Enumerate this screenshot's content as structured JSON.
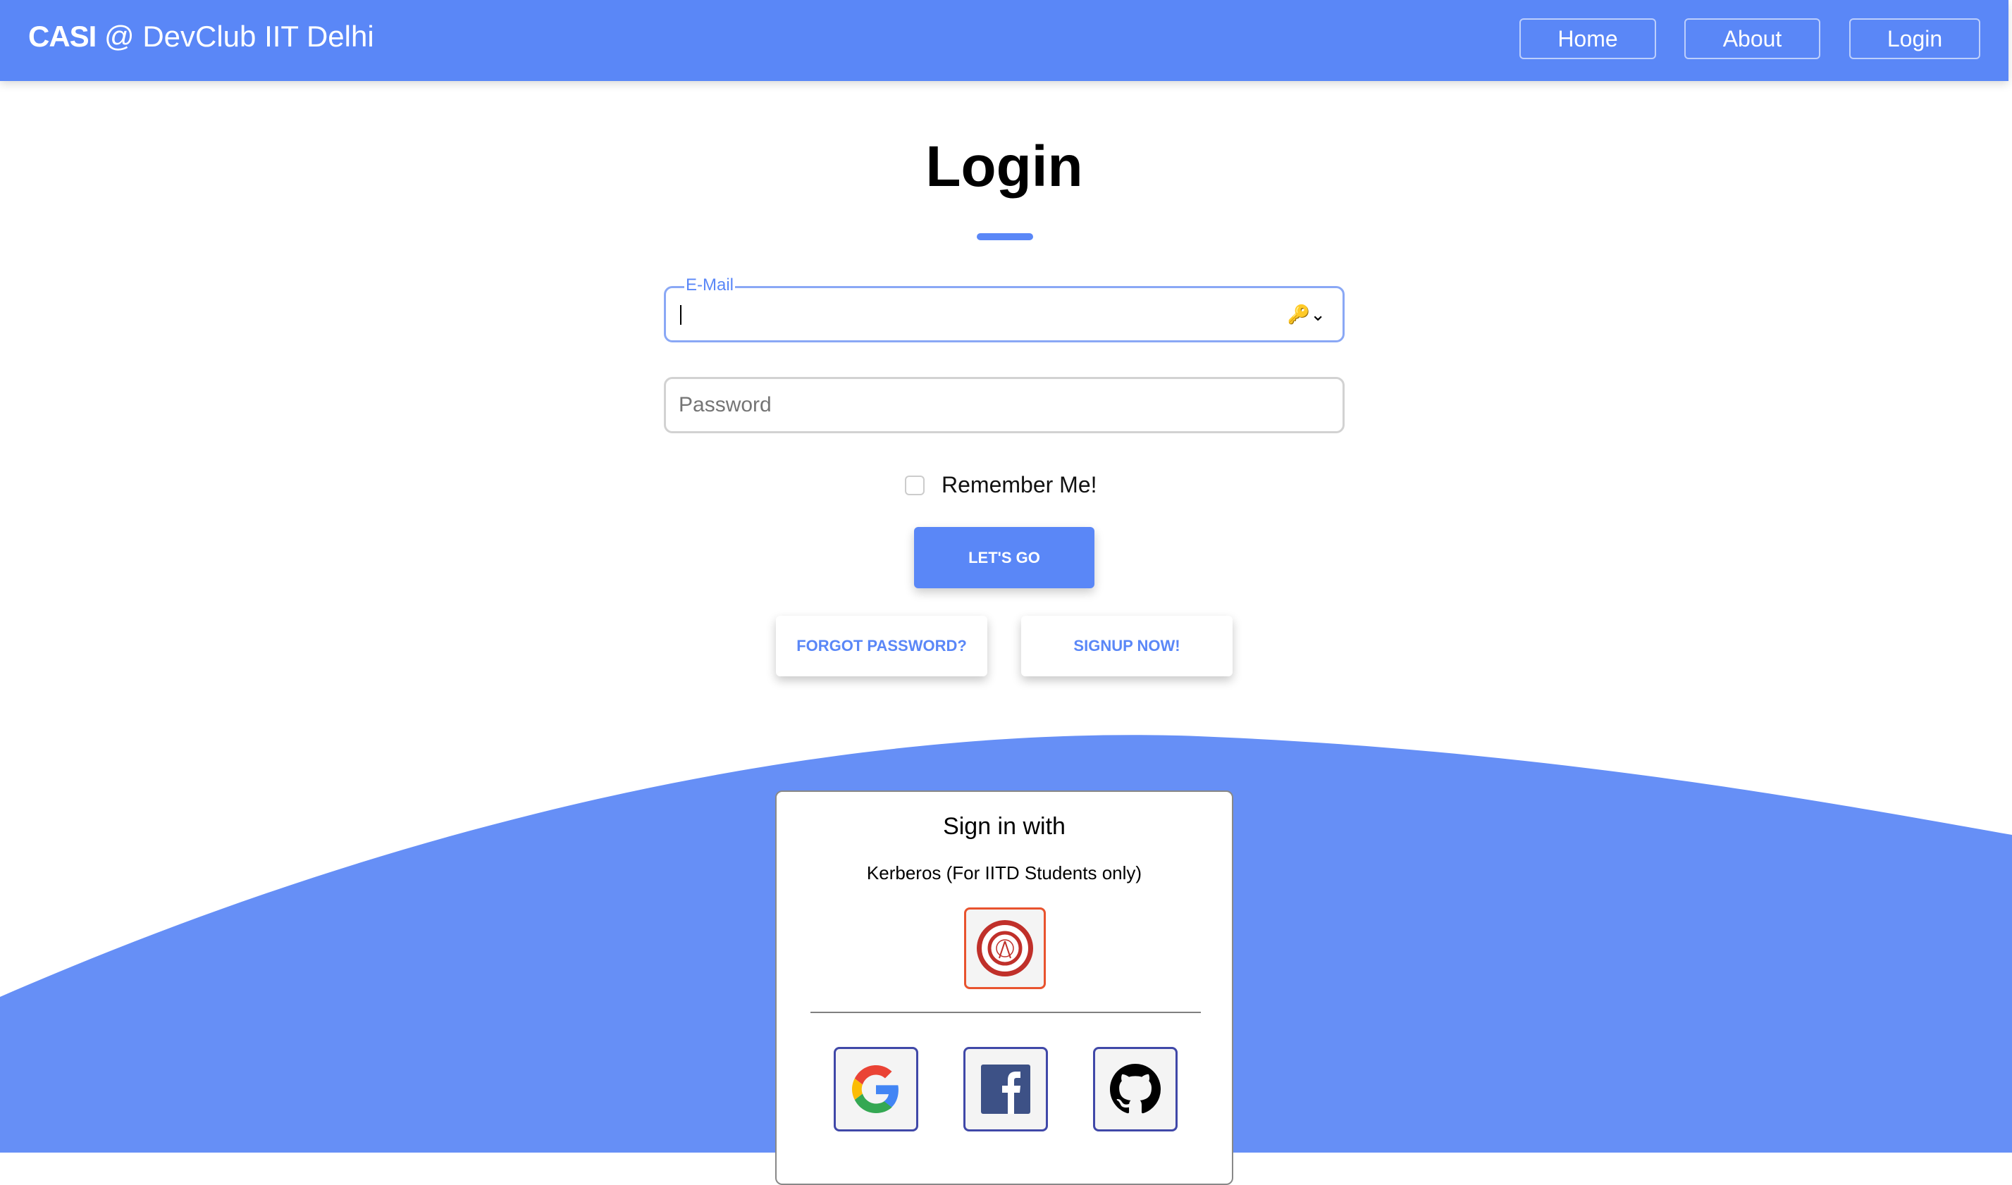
{
  "navbar": {
    "brand_bold": "CASI",
    "brand_rest": " @ DevClub IIT Delhi",
    "links": [
      "Home",
      "About",
      "Login"
    ]
  },
  "main": {
    "title": "Login",
    "email": {
      "label": "E-Mail",
      "value": "",
      "icon": "password-key-icon"
    },
    "password": {
      "placeholder": "Password"
    },
    "remember": {
      "label": "Remember Me!",
      "checked": false
    },
    "submit_label": "LET'S GO",
    "forgot_label": "FORGOT PASSWORD?",
    "signup_label": "SIGNUP NOW!"
  },
  "social": {
    "title": "Sign in with",
    "kerberos_label": "Kerberos (For IITD Students only)",
    "providers": [
      "iitd-logo-icon",
      "google-icon",
      "facebook-icon",
      "github-icon"
    ]
  },
  "colors": {
    "primary": "#5a87f7",
    "wave": "#668ff6",
    "kerberos_border": "#e8532e",
    "provider_border": "#4048a8"
  }
}
